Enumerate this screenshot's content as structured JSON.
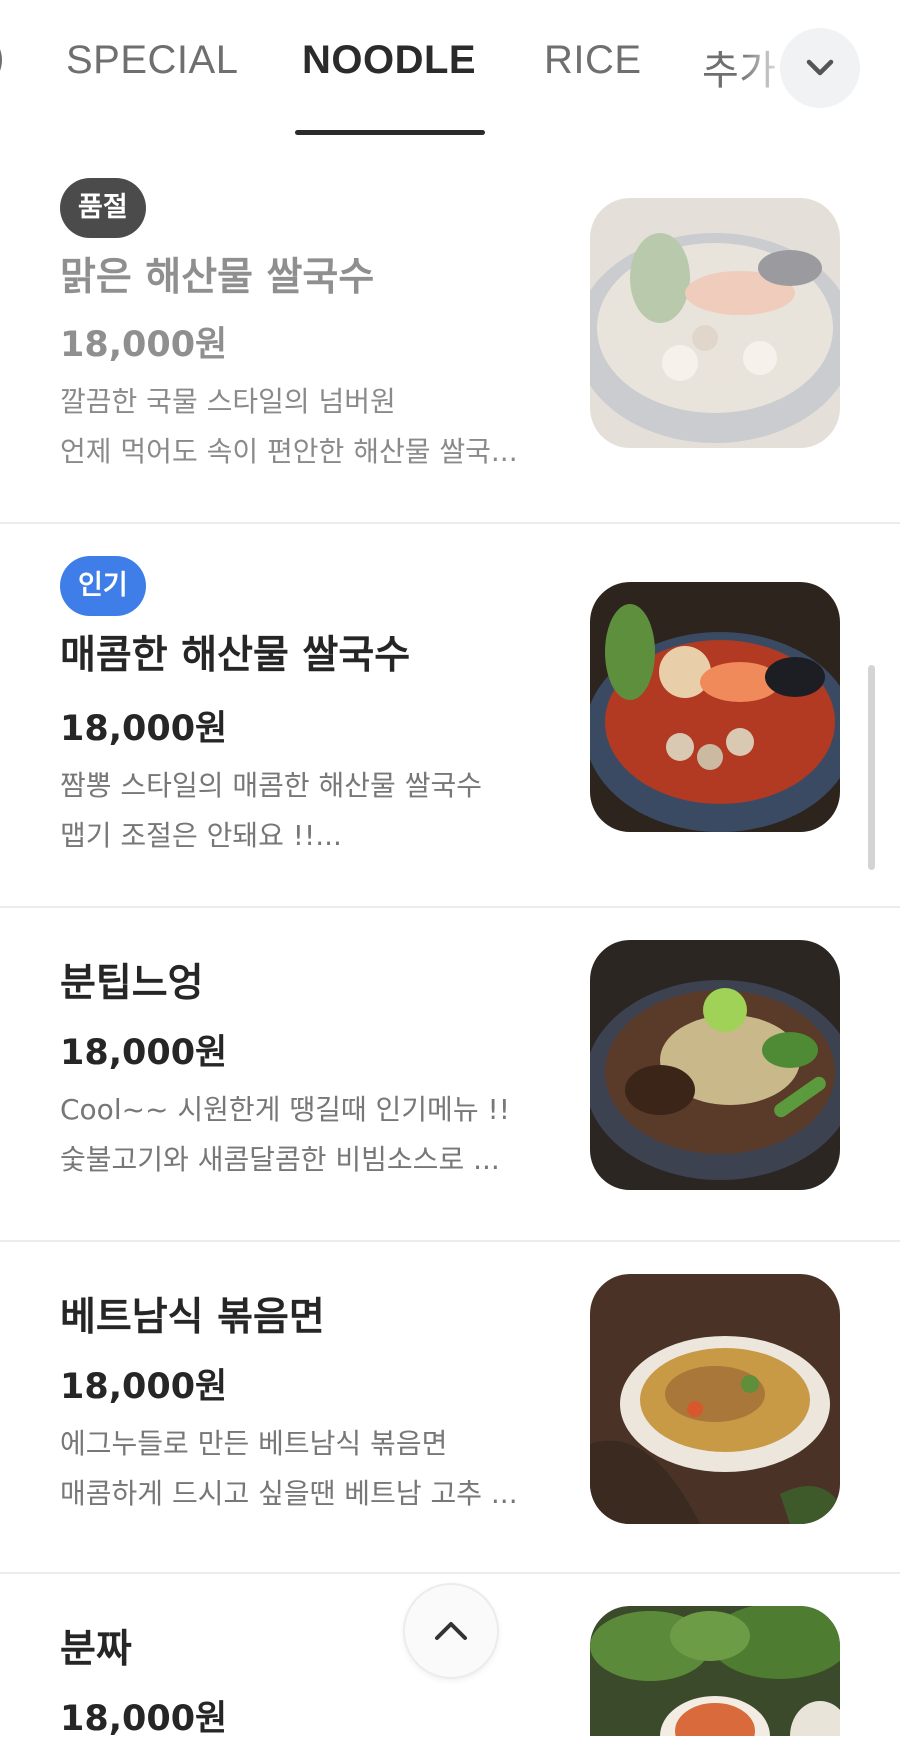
{
  "tabs": [
    {
      "label": "SPECIAL",
      "active": false
    },
    {
      "label": "NOODLE",
      "active": true
    },
    {
      "label": "RICE",
      "active": false
    },
    {
      "label": "추가",
      "active": false
    }
  ],
  "expand_icon": "chevron-down-icon",
  "scroll_top_icon": "chevron-up-icon",
  "colors": {
    "popular_badge": "#3f7ee8",
    "soldout_badge": "#4b4b4b"
  },
  "items": [
    {
      "badge": "품절",
      "name": "맑은 해산물 쌀국수",
      "price": "18,000원",
      "desc1": "깔끔한 국물 스타일의 넘버원",
      "desc2": "언제 먹어도 속이 편안한 해산물 쌀국...",
      "sold_out": true
    },
    {
      "badge": "인기",
      "name": "매콤한 해산물 쌀국수",
      "price": "18,000원",
      "desc1": "짬뽕 스타일의 매콤한 해산물 쌀국수",
      "desc2": "맵기 조절은 안돼요 !!...",
      "sold_out": false
    },
    {
      "name": "분팁느엉",
      "price": "18,000원",
      "desc1": "Cool~~ 시원한게 땡길때 인기메뉴 !!",
      "desc2": "숯불고기와 새콤달콤한 비빔소스로 ...",
      "sold_out": false
    },
    {
      "name": "베트남식 볶음면",
      "price": "18,000원",
      "desc1": "에그누들로 만든 베트남식 볶음면",
      "desc2": "매콤하게 드시고 싶을땐 베트남 고추 ...",
      "sold_out": false
    },
    {
      "name": "분짜",
      "price": "18,000원",
      "sold_out": false
    }
  ]
}
